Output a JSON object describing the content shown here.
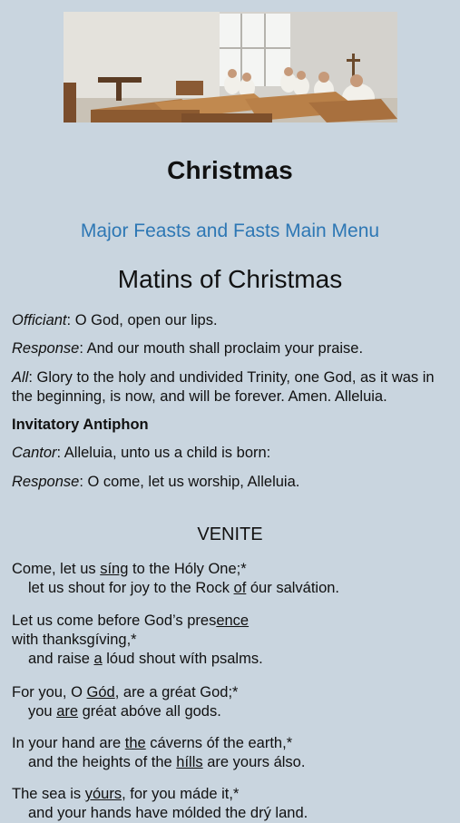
{
  "header": {
    "image_alt": "Monastery chapel with monks seated at wooden choir stalls"
  },
  "page": {
    "title": "Christmas",
    "menu_link": "Major Feasts and Fasts Main Menu",
    "section_title": "Matins of Christmas"
  },
  "dialogue": [
    {
      "role": "Officiant",
      "text": ": O God, open our lips."
    },
    {
      "role": "Response",
      "text": ": And our mouth shall proclaim your praise."
    },
    {
      "role": "All",
      "text": ": Glory to the holy and undivided Trinity, one God, as it was in",
      "text2": "the beginning, is now, and will be forever. Amen. Alleluia."
    },
    {
      "heading": "Invitatory Antiphon"
    },
    {
      "role": "Cantor",
      "text": ": Alleluia, unto us a child is born:"
    },
    {
      "role": "Response",
      "text": ": O come, let us worship, Alleluia."
    }
  ],
  "psalm": {
    "title": "VENITE",
    "v1a_pre": "Come, let us ",
    "v1a_u": "síng",
    "v1a_post": " to the Hóly One;*",
    "v1b_pre": "let us shout for joy to the Rock ",
    "v1b_u": "of",
    "v1b_post": " óur salvátion.",
    "v2a_pre": "Let us come before God’s pres",
    "v2a_u": "ence",
    "v2b": "with thanksgíving,*",
    "v2c_pre": "and raise ",
    "v2c_u": "a",
    "v2c_post": " lóud shout wíth psalms.",
    "v3a_pre": "For you, O ",
    "v3a_u": "Gód",
    "v3a_post": ", are a gréat God;*",
    "v3b_pre": "you ",
    "v3b_u": "are",
    "v3b_post": " gréat abóve all gods.",
    "v4a_pre": "In your hand are ",
    "v4a_u": "the",
    "v4a_post": " cáverns óf the earth,*",
    "v4b_pre": "and the heights of the ",
    "v4b_u": "hílls",
    "v4b_post": " are yours álso.",
    "v5a_pre": "The sea is ",
    "v5a_u": "yóurs",
    "v5a_post": ", for you máde it,*",
    "v5b": "and your hands have mólded the drý land."
  }
}
